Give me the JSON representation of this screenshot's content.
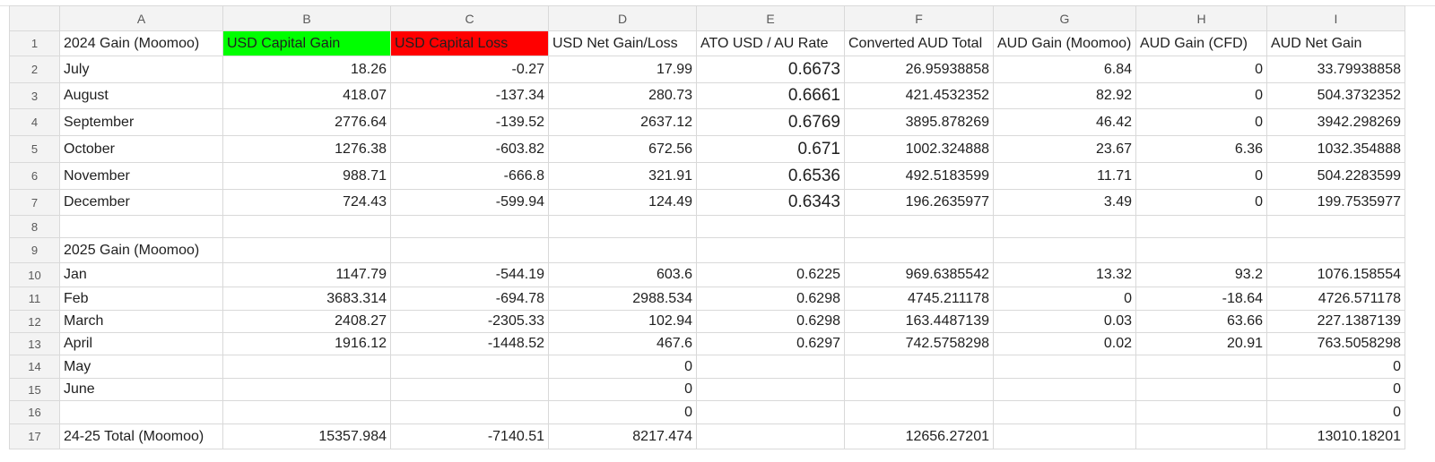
{
  "sheet": {
    "columns": [
      "A",
      "B",
      "C",
      "D",
      "E",
      "F",
      "G",
      "H",
      "I"
    ],
    "row_numbers": [
      "1",
      "2",
      "3",
      "4",
      "5",
      "6",
      "7",
      "8",
      "9",
      "10",
      "11",
      "12",
      "13",
      "14",
      "15",
      "16",
      "17"
    ],
    "colors": {
      "usd_gain_fill": "#00ff00",
      "usd_loss_fill": "#ff0000",
      "header_bg": "#f3f3f3",
      "gridline": "#d9d9d9"
    },
    "rows": [
      [
        "2024 Gain (Moomoo)",
        "USD Capital Gain",
        "USD Capital Loss",
        "USD Net Gain/Loss",
        "ATO USD / AU Rate",
        "Converted AUD Total",
        "AUD Gain (Moomoo)",
        "AUD Gain (CFD)",
        "AUD Net Gain"
      ],
      [
        "July",
        "18.26",
        "-0.27",
        "17.99",
        "0.6673",
        "26.95938858",
        "6.84",
        "0",
        "33.79938858"
      ],
      [
        "August",
        "418.07",
        "-137.34",
        "280.73",
        "0.6661",
        "421.4532352",
        "82.92",
        "0",
        "504.3732352"
      ],
      [
        "September",
        "2776.64",
        "-139.52",
        "2637.12",
        "0.6769",
        "3895.878269",
        "46.42",
        "0",
        "3942.298269"
      ],
      [
        "October",
        "1276.38",
        "-603.82",
        "672.56",
        "0.671",
        "1002.324888",
        "23.67",
        "6.36",
        "1032.354888"
      ],
      [
        "November",
        "988.71",
        "-666.8",
        "321.91",
        "0.6536",
        "492.5183599",
        "11.71",
        "0",
        "504.2283599"
      ],
      [
        "December",
        "724.43",
        "-599.94",
        "124.49",
        "0.6343",
        "196.2635977",
        "3.49",
        "0",
        "199.7535977"
      ],
      [
        "",
        "",
        "",
        "",
        "",
        "",
        "",
        "",
        ""
      ],
      [
        "2025 Gain (Moomoo)",
        "",
        "",
        "",
        "",
        "",
        "",
        "",
        ""
      ],
      [
        "Jan",
        "1147.79",
        "-544.19",
        "603.6",
        "0.6225",
        "969.6385542",
        "13.32",
        "93.2",
        "1076.158554"
      ],
      [
        "Feb",
        "3683.314",
        "-694.78",
        "2988.534",
        "0.6298",
        "4745.211178",
        "0",
        "-18.64",
        "4726.571178"
      ],
      [
        "March",
        "2408.27",
        "-2305.33",
        "102.94",
        "0.6298",
        "163.4487139",
        "0.03",
        "63.66",
        "227.1387139"
      ],
      [
        "April",
        "1916.12",
        "-1448.52",
        "467.6",
        "0.6297",
        "742.5758298",
        "0.02",
        "20.91",
        "763.5058298"
      ],
      [
        "May",
        "",
        "",
        "0",
        "",
        "",
        "",
        "",
        "0"
      ],
      [
        "June",
        "",
        "",
        "0",
        "",
        "",
        "",
        "",
        "0"
      ],
      [
        "",
        "",
        "",
        "0",
        "",
        "",
        "",
        "",
        "0"
      ],
      [
        "24-25 Total (Moomoo)",
        "15357.984",
        "-7140.51",
        "8217.474",
        "",
        "12656.27201",
        "",
        "",
        "13010.18201"
      ]
    ]
  }
}
